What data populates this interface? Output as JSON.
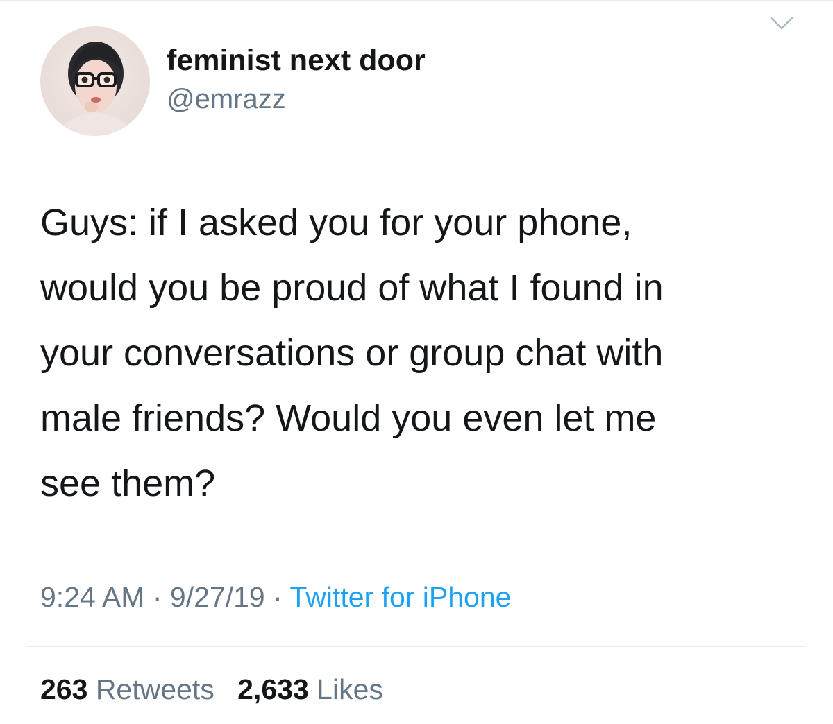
{
  "tweet": {
    "author": {
      "display_name": "feminist next door",
      "handle": "@emrazz"
    },
    "text_lines": [
      "Guys: if I asked you for your phone,",
      "would you be proud of what I found in",
      "your conversations or group chat with",
      "male friends? Would you even let me",
      "see them?"
    ],
    "meta": {
      "time": "9:24 AM",
      "separator": "·",
      "date": "9/27/19",
      "source": "Twitter for iPhone"
    },
    "stats": {
      "retweets_count": "263",
      "retweets_label": "Retweets",
      "likes_count": "2,633",
      "likes_label": "Likes"
    },
    "menu_icon": "chevron-down-icon"
  },
  "colors": {
    "text": "#14171a",
    "secondary": "#657786",
    "link": "#1da1f2",
    "divider": "#e6ecf0"
  }
}
